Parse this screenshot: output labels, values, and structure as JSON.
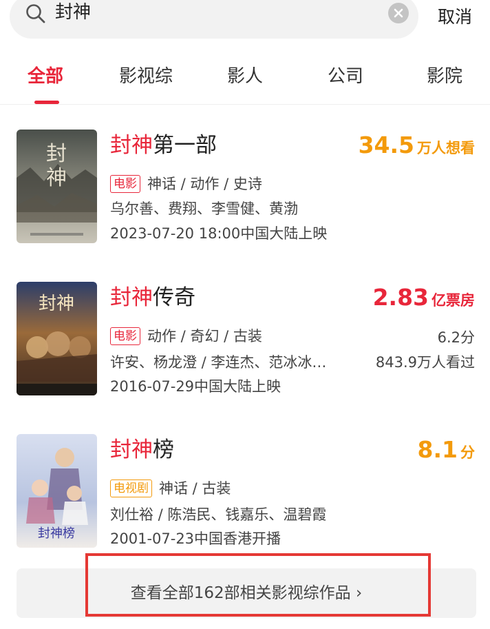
{
  "search": {
    "query": "封神",
    "cancel_label": "取消",
    "icons": {
      "search": "search-icon",
      "clear": "clear-icon"
    }
  },
  "tabs": [
    {
      "label": "全部",
      "active": true
    },
    {
      "label": "影视综",
      "active": false
    },
    {
      "label": "影人",
      "active": false
    },
    {
      "label": "公司",
      "active": false
    },
    {
      "label": "影院",
      "active": false
    }
  ],
  "results": [
    {
      "title_highlight": "封神",
      "title_rest": "第一部",
      "metric_value": "34.5",
      "metric_unit": "万人想看",
      "metric_color": "#f39a0b",
      "badge": "电影",
      "genres": "神话 / 动作 / 史诗",
      "cast": "乌尔善、费翔、李雪健、黄渤",
      "release": "2023-07-20 18:00中国大陆上映"
    },
    {
      "title_highlight": "封神",
      "title_rest": "传奇",
      "metric_value": "2.83",
      "metric_unit": "亿票房",
      "metric_color": "#e8263a",
      "badge": "电影",
      "genres": "动作 / 奇幻 / 古装",
      "score": "6.2分",
      "cast": "许安、杨龙澄 / 李连杰、范冰冰…",
      "viewers": "843.9万人看过",
      "release": "2016-07-29中国大陆上映"
    },
    {
      "title_highlight": "封神",
      "title_rest": "榜",
      "metric_value": "8.1",
      "metric_unit": "分",
      "metric_color": "#f39a0b",
      "badge": "电视剧",
      "genres": "神话 / 古装",
      "cast": "刘仕裕 / 陈浩民、钱嘉乐、温碧霞",
      "release": "2001-07-23中国香港开播"
    }
  ],
  "view_all": {
    "label": "查看全部162部相关影视综作品 ›"
  },
  "colors": {
    "accent_red": "#e8263a",
    "accent_orange": "#f39a0b",
    "annotation_box": "#e53935"
  }
}
